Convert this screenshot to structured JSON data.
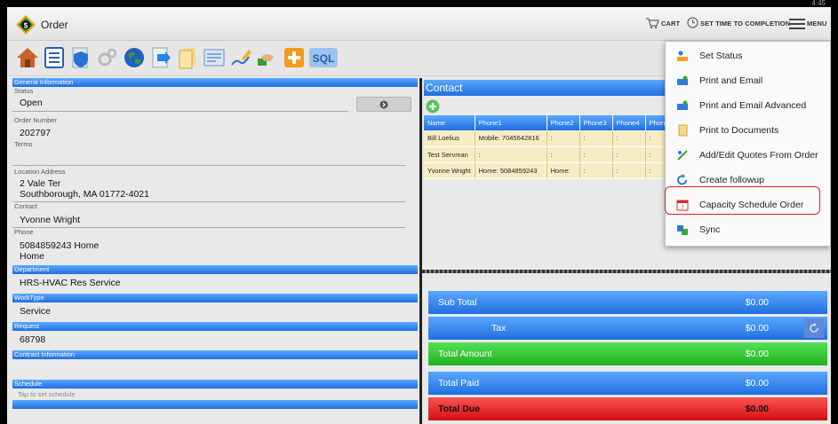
{
  "status_bar": {
    "time": "4:45"
  },
  "app": {
    "title": "Order"
  },
  "action_bar": {
    "cart_label": "CART",
    "set_time_label": "SET TIME TO COMPLETION",
    "menu_label": "MENU"
  },
  "toolbar": {
    "icons": [
      "house-icon",
      "list-icon",
      "document-shield-icon",
      "gears-icon",
      "globe-icon",
      "document-arrow-icon",
      "document-stack-icon",
      "form-icon",
      "pencil-icon",
      "handshake-icon",
      "medical-plus-icon",
      "sql-icon"
    ],
    "sql_label": "SQL"
  },
  "form": {
    "general_information": "General Information",
    "status_label": "Status",
    "status_value": "Open",
    "order_number_label": "Order Number",
    "order_number_value": "202797",
    "terms_label": "Terms",
    "terms_value": "",
    "location_label": "Location Address",
    "location_line1": "2 Vale Ter",
    "location_line2": "Southborough, MA 01772-4021",
    "contact_label": "Contact",
    "contact_value": "Yvonne Wright",
    "phone_label": "Phone",
    "phone_line1": "5084859243 Home",
    "phone_line2": "Home",
    "department_label": "Department",
    "department_value": "HRS-HVAC Res Service",
    "worktype_label": "WorkType",
    "worktype_value": "Service",
    "request_label": "Request",
    "request_value": "68798",
    "contract_label": "Contract Information",
    "schedule_label": "Schedule",
    "schedule_hint": "Tap to set schedule"
  },
  "contacts": {
    "title": "Contact",
    "columns": [
      "Name",
      "Phone1",
      "Phone2",
      "Phone3",
      "Phone4",
      "Phon"
    ],
    "rows": [
      [
        "Bill Loelius",
        "Mobile: 7045642816",
        ":",
        ":",
        ":",
        ":"
      ],
      [
        "Test Servman",
        ":",
        ":",
        ":",
        ":",
        ":"
      ],
      [
        "Yvonne Wright",
        "Home: 5084859243",
        "Home:",
        ":",
        ":",
        ":"
      ]
    ]
  },
  "totals": {
    "sub_total_label": "Sub Total",
    "sub_total_value": "$0.00",
    "tax_label": "Tax",
    "tax_value": "$0.00",
    "total_amount_label": "Total Amount",
    "total_amount_value": "$0.00",
    "total_paid_label": "Total Paid",
    "total_paid_value": "$0.00",
    "total_due_label": "Total Due",
    "total_due_value": "$0.00"
  },
  "menu": {
    "items": [
      {
        "label": "Set Status",
        "icon": "flag-person-icon"
      },
      {
        "label": "Print and Email",
        "icon": "printer-person-icon"
      },
      {
        "label": "Print and Email Advanced",
        "icon": "printer-person-advanced-icon"
      },
      {
        "label": "Print to Documents",
        "icon": "document-icon"
      },
      {
        "label": "Add/Edit Quotes From Order",
        "icon": "quote-edit-icon"
      },
      {
        "label": "Create followup",
        "icon": "followup-arrow-icon"
      },
      {
        "label": "Capacity Schedule Order",
        "icon": "calendar-icon"
      },
      {
        "label": "Sync",
        "icon": "sync-icon"
      }
    ]
  },
  "colors": {
    "blue": "#1f6fe0",
    "green": "#22b022",
    "red": "#d21010",
    "highlight": "#e02020",
    "row": "#f6edc5"
  }
}
